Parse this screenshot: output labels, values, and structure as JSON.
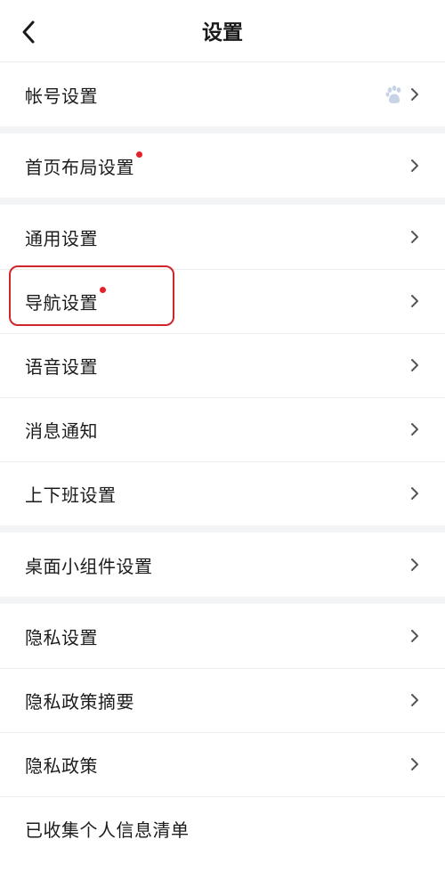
{
  "header": {
    "title": "设置",
    "back_icon": "chevron-left-icon"
  },
  "groups": [
    {
      "items": [
        {
          "label": "帐号设置",
          "badge_dot": false,
          "right_icon": "baidu-paw-icon"
        }
      ]
    },
    {
      "items": [
        {
          "label": "首页布局设置",
          "badge_dot": true
        }
      ]
    },
    {
      "items": [
        {
          "label": "通用设置",
          "badge_dot": false
        },
        {
          "label": "导航设置",
          "badge_dot": true,
          "highlighted": true
        },
        {
          "label": "语音设置",
          "badge_dot": false
        },
        {
          "label": "消息通知",
          "badge_dot": false
        },
        {
          "label": "上下班设置",
          "badge_dot": false
        }
      ]
    },
    {
      "items": [
        {
          "label": "桌面小组件设置",
          "badge_dot": false
        }
      ]
    },
    {
      "items": [
        {
          "label": "隐私设置",
          "badge_dot": false
        },
        {
          "label": "隐私政策摘要",
          "badge_dot": false
        },
        {
          "label": "隐私政策",
          "badge_dot": false
        },
        {
          "label": "已收集个人信息清单",
          "badge_dot": false
        }
      ]
    }
  ],
  "colors": {
    "badge_dot": "#e8202a",
    "highlight_border": "#d0252b",
    "separator": "#ededed",
    "group_gap": "#f3f4f6",
    "chevron": "#555555"
  }
}
